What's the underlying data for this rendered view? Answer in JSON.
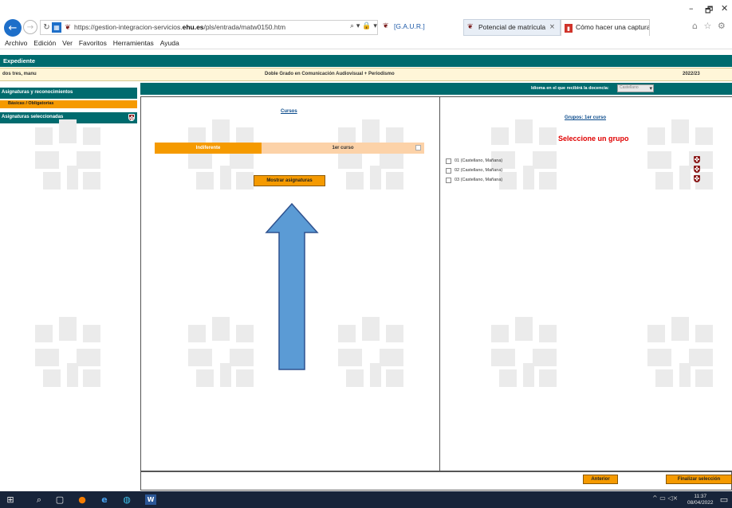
{
  "browser": {
    "url_prefix": "https://gestion-integracion-servicios.",
    "url_host_bold": "ehu.es",
    "url_suffix": "/pls/entrada/matw0150.htm",
    "search_glyph": "⌕ ▾ 🔒 ▾",
    "tabs": [
      {
        "label": "[G.A.U.R.]"
      },
      {
        "label": "Potencial de matrícula"
      },
      {
        "label": "Cómo hacer una captura de pa..."
      }
    ],
    "window_controls": {
      "minimize": "–",
      "maximize": "🗗",
      "close": "✕"
    },
    "toolbar_icons": "⌂ ☆ ⚙"
  },
  "menubar": {
    "items": [
      "Archivo",
      "Edición",
      "Ver",
      "Favoritos",
      "Herramientas",
      "Ayuda"
    ]
  },
  "page": {
    "section_title": "Expediente",
    "student_name": "dos tres, manu",
    "degree": "Doble Grado en Comunicación Audiovisual + Periodismo",
    "academic_year": "2022/23",
    "sidebar": {
      "heading": "Asignaturas y reconocimientos",
      "subitem": "Básicas / Obligatorias",
      "selected_heading": "Asignaturas seleccionadas"
    },
    "language": {
      "label": "Idioma en el que recibirá la docencia:",
      "value": "Castellano"
    },
    "cursos": {
      "title": "Cursos",
      "indiferente": "Indiferente",
      "first_year": "1er curso",
      "show_button": "Mostrar asignaturas"
    },
    "grupos": {
      "title": "Grupos:   1er curso",
      "prompt": "Seleccione un grupo",
      "items": [
        {
          "label": "01 (Castellano, Mañana)"
        },
        {
          "label": "02 (Castellano, Mañana)"
        },
        {
          "label": "03 (Castellano, Mañana)"
        }
      ]
    },
    "footer": {
      "previous": "Anterior",
      "finish": "Finalizar selección"
    }
  },
  "taskbar": {
    "time": "11:37",
    "date": "08/04/2022"
  },
  "colors": {
    "teal": "#006b6e",
    "orange": "#f59a00",
    "peach": "#fcd2a8",
    "arrow_blue": "#5b9bd5",
    "arrow_stroke": "#2f528f",
    "alert_red": "#e00000"
  }
}
